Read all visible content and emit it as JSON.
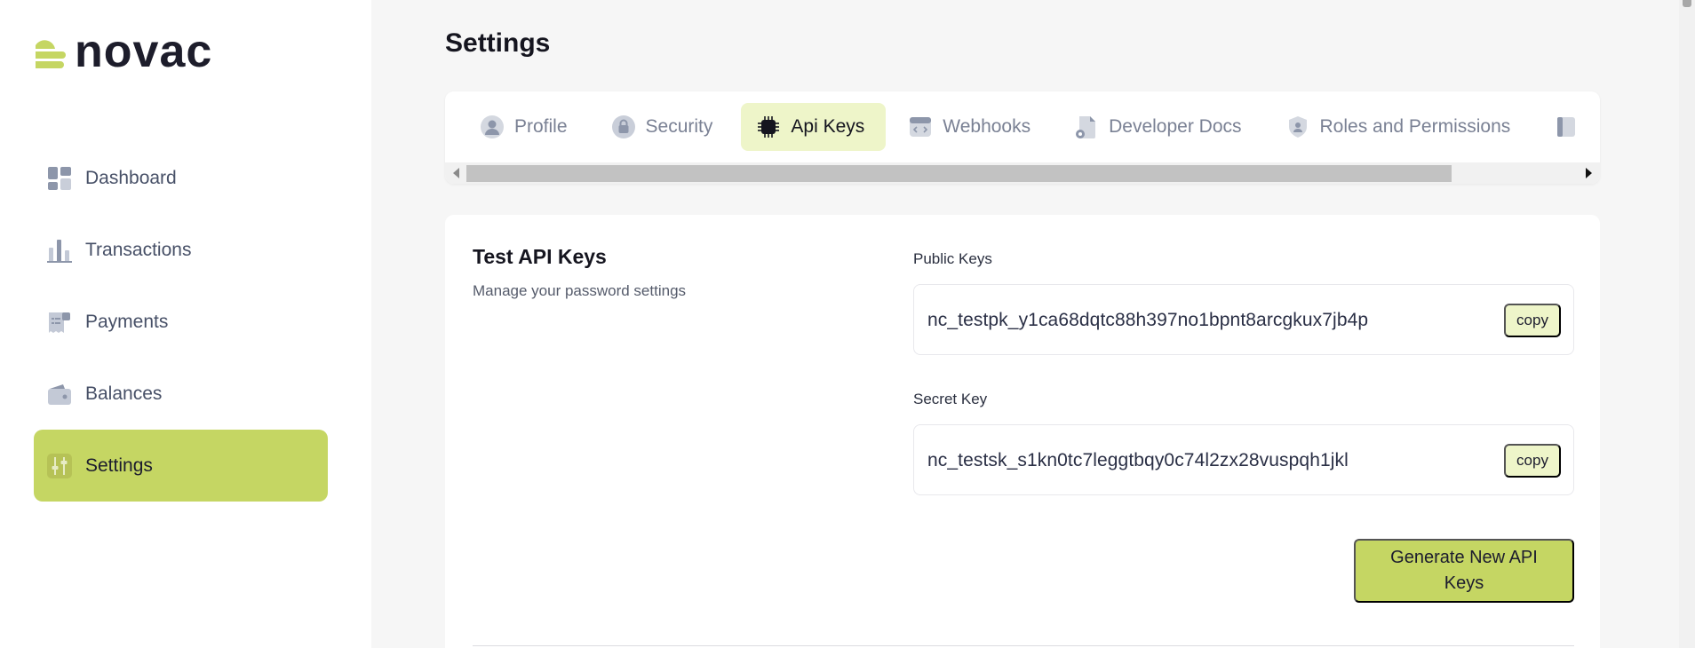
{
  "brand": {
    "name": "novac",
    "color": "#c5d663"
  },
  "sidebar": {
    "items": [
      {
        "label": "Dashboard",
        "icon": "dashboard-icon"
      },
      {
        "label": "Transactions",
        "icon": "bar-chart-icon"
      },
      {
        "label": "Payments",
        "icon": "receipt-icon"
      },
      {
        "label": "Balances",
        "icon": "wallet-icon"
      },
      {
        "label": "Settings",
        "icon": "sliders-icon",
        "active": true
      }
    ]
  },
  "page": {
    "title": "Settings"
  },
  "tabs": [
    {
      "label": "Profile",
      "icon": "user-icon"
    },
    {
      "label": "Security",
      "icon": "lock-icon"
    },
    {
      "label": "Api Keys",
      "icon": "chip-icon",
      "active": true
    },
    {
      "label": "Webhooks",
      "icon": "code-window-icon"
    },
    {
      "label": "Developer Docs",
      "icon": "document-icon"
    },
    {
      "label": "Roles and Permissions",
      "icon": "shield-user-icon"
    }
  ],
  "api_keys": {
    "title": "Test API Keys",
    "subtitle": "Manage your password settings",
    "public_label": "Public Keys",
    "public_key": "nc_testpk_y1ca68dqtc88h397no1bpnt8arcgkux7jb4p",
    "secret_label": "Secret Key",
    "secret_key": "nc_testsk_s1kn0tc7leggtbqy0c74l2zx28vuspqh1jkl",
    "copy_label": "copy",
    "generate_label": "Generate New API Keys"
  }
}
